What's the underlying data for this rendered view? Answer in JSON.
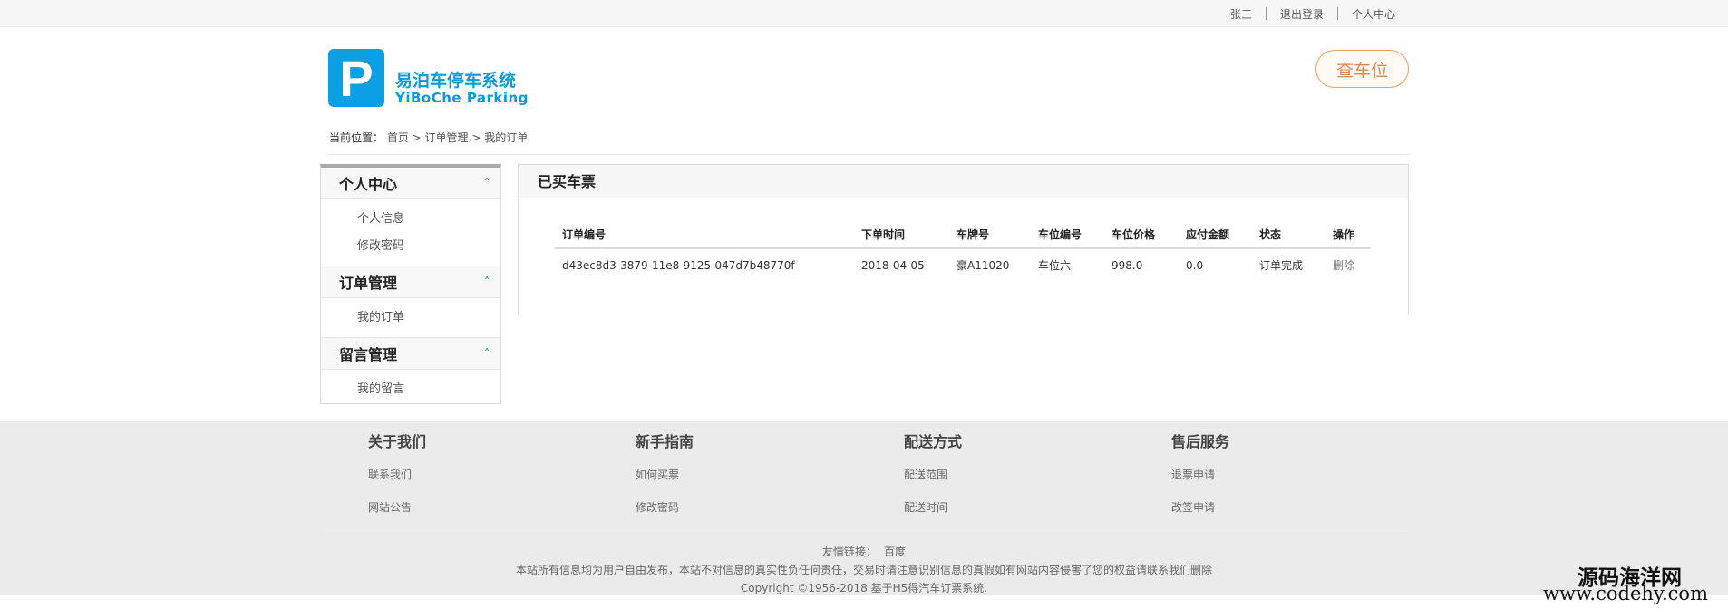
{
  "topbar": {
    "username": "张三",
    "logout": "退出登录",
    "profile": "个人中心"
  },
  "header": {
    "logo_letter": "P",
    "brand_cn": "易泊车停车系统",
    "brand_en": "YiBoChe  Parking",
    "find_button": "查车位"
  },
  "breadcrumb": {
    "label": "当前位置：",
    "path": "首页 > 订单管理 > 我的订单"
  },
  "sidebar": {
    "groups": [
      {
        "title": "个人中心",
        "items": [
          "个人信息",
          "修改密码"
        ]
      },
      {
        "title": "订单管理",
        "items": [
          "我的订单"
        ]
      },
      {
        "title": "留言管理",
        "items": [
          "我的留言"
        ]
      }
    ]
  },
  "panel": {
    "title": "已买车票",
    "columns": [
      "订单编号",
      "下单时间",
      "车牌号",
      "车位编号",
      "车位价格",
      "应付金额",
      "状态",
      "操作"
    ],
    "rows": [
      {
        "order_id": "d43ec8d3-3879-11e8-9125-047d7b48770f",
        "date": "2018-04-05",
        "plate": "豪A11020",
        "space": "车位六",
        "price": "998.0",
        "due": "0.0",
        "status": "订单完成",
        "action": "删除"
      }
    ]
  },
  "footer": {
    "columns": [
      {
        "title": "关于我们",
        "links": [
          "联系我们",
          "网站公告"
        ]
      },
      {
        "title": "新手指南",
        "links": [
          "如何买票",
          "修改密码"
        ]
      },
      {
        "title": "配送方式",
        "links": [
          "配送范围",
          "配送时间"
        ]
      },
      {
        "title": "售后服务",
        "links": [
          "退票申请",
          "改签申请"
        ]
      }
    ],
    "friend_label": "友情链接：",
    "friend_link": "百度",
    "notice": "本站所有信息均为用户自由发布，本站不对信息的真实性负任何责任，交易时请注意识别信息的真假如有网站内容侵害了您的权益请联系我们删除",
    "copyright": "Copyright ©1956-2018 基于H5得汽车订票系统."
  },
  "watermark": {
    "cn": "源码海洋网",
    "en": "www.codehy.com"
  },
  "colors": {
    "brand": "#0aa0e3",
    "accent_orange": "#e0864a",
    "status_green": "#2e8b2e"
  }
}
